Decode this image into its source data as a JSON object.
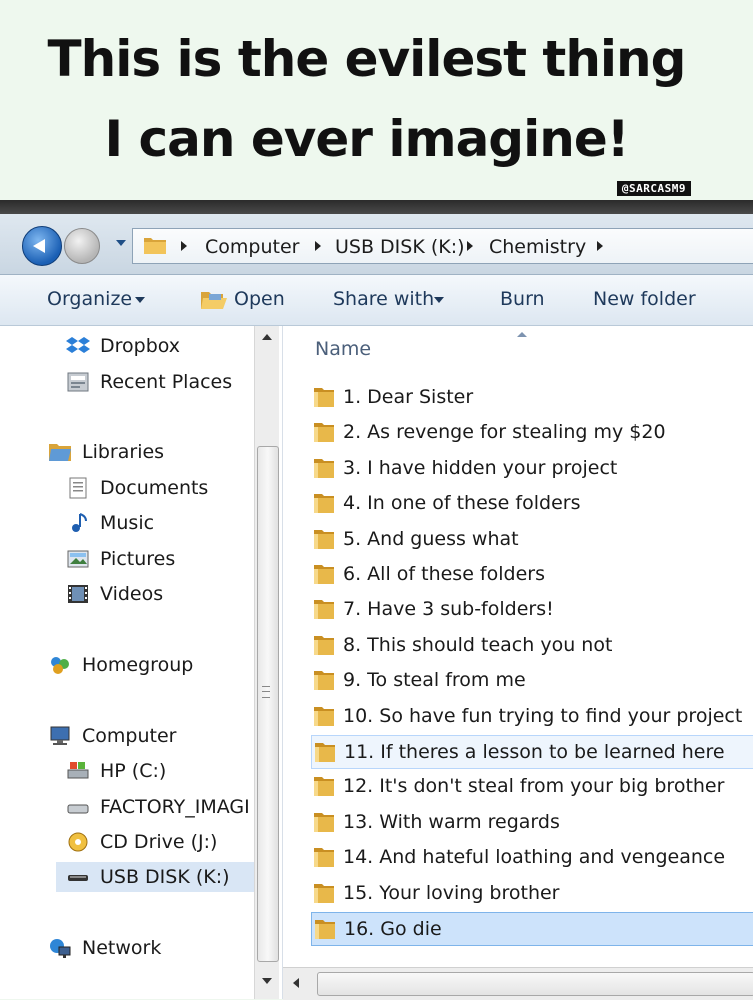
{
  "meme": {
    "title_line1": "This is the evilest thing",
    "title_line2": "I can ever imagine!",
    "watermark": "@SARCASM9"
  },
  "address_bar": {
    "crumbs": [
      "Computer",
      "USB DISK (K:)",
      "Chemistry"
    ]
  },
  "toolbar": {
    "organize": "Organize",
    "open": "Open",
    "share_with": "Share with",
    "burn": "Burn",
    "new_folder": "New folder"
  },
  "nav": {
    "favorites": [
      {
        "label": "Dropbox",
        "icon": "dropbox-icon"
      },
      {
        "label": "Recent Places",
        "icon": "recent-places-icon"
      }
    ],
    "libraries": {
      "label": "Libraries",
      "icon": "libraries-icon"
    },
    "library_items": [
      {
        "label": "Documents",
        "icon": "documents-icon"
      },
      {
        "label": "Music",
        "icon": "music-icon"
      },
      {
        "label": "Pictures",
        "icon": "pictures-icon"
      },
      {
        "label": "Videos",
        "icon": "videos-icon"
      }
    ],
    "homegroup": {
      "label": "Homegroup",
      "icon": "homegroup-icon"
    },
    "computer": {
      "label": "Computer",
      "icon": "computer-icon"
    },
    "drives": [
      {
        "label": "HP (C:)",
        "icon": "hard-drive-icon"
      },
      {
        "label": "FACTORY_IMAGI",
        "icon": "drive-icon"
      },
      {
        "label": "CD Drive (J:)",
        "icon": "cd-drive-icon"
      },
      {
        "label": "USB DISK (K:)",
        "icon": "usb-drive-icon",
        "selected": true
      }
    ],
    "network": {
      "label": "Network",
      "icon": "network-icon"
    }
  },
  "content": {
    "column_name": "Name",
    "folders": [
      "1. Dear Sister",
      "2. As revenge for stealing my $20",
      "3. I have hidden your project",
      "4. In one of these folders",
      "5. And guess what",
      "6. All of these folders",
      "7. Have 3 sub-folders!",
      "8. This should teach you not",
      "9. To steal from me",
      "10. So have fun trying to find your project",
      "11. If theres a lesson to be learned here",
      "12. It's don't steal from your big brother",
      "13. With warm regards",
      "14. And hateful loathing and vengeance",
      "15. Your loving brother",
      "16. Go die"
    ],
    "hover_index": 10,
    "selected_index": 15
  },
  "colors": {
    "folder": "#e8b84a",
    "selection": "#cde3fb",
    "toolbar_text": "#1e395b"
  }
}
